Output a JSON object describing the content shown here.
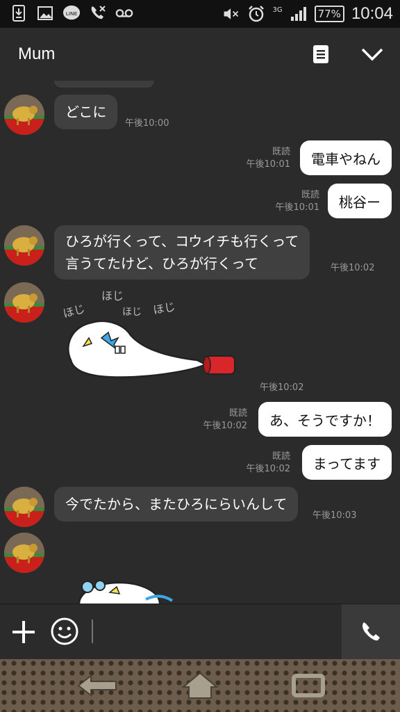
{
  "status": {
    "network": "3G",
    "battery": "77%",
    "time": "10:04",
    "left_icons": [
      "download-icon",
      "image-icon",
      "line-icon",
      "missed-call-icon",
      "voicemail-icon"
    ],
    "right_icons": [
      "mute-icon",
      "alarm-icon",
      "signal-icon",
      "battery-icon"
    ]
  },
  "header": {
    "title": "Mum"
  },
  "messages": [
    {
      "side": "in",
      "text": "どこに",
      "time": "午後10:00"
    },
    {
      "side": "out",
      "text": "電車やねん",
      "read": "既読",
      "time": "午後10:01"
    },
    {
      "side": "out",
      "text": "桃谷ー",
      "read": "既読",
      "time": "午後10:01"
    },
    {
      "side": "in",
      "text_lines": [
        "ひろが行くって、コウイチも行くって",
        "言うてたけど、ひろが行くって"
      ],
      "time": "午後10:02"
    },
    {
      "side": "in",
      "sticker": true,
      "sticker_text": [
        "ほじ",
        "ほじ",
        "ほじ",
        "ほじ"
      ],
      "time": "午後10:02"
    },
    {
      "side": "out",
      "text": "あ、そうですか！",
      "read": "既読",
      "time": "午後10:02"
    },
    {
      "side": "out",
      "text": "まってます",
      "read": "既読",
      "time": "午後10:02"
    },
    {
      "side": "in",
      "text": "今でたから、またひろにらいんして",
      "time": "午後10:03"
    },
    {
      "side": "in",
      "sticker": true
    }
  ],
  "colors": {
    "background": "#2b2b2b",
    "incoming": "#404040",
    "outgoing": "#ffffff"
  }
}
